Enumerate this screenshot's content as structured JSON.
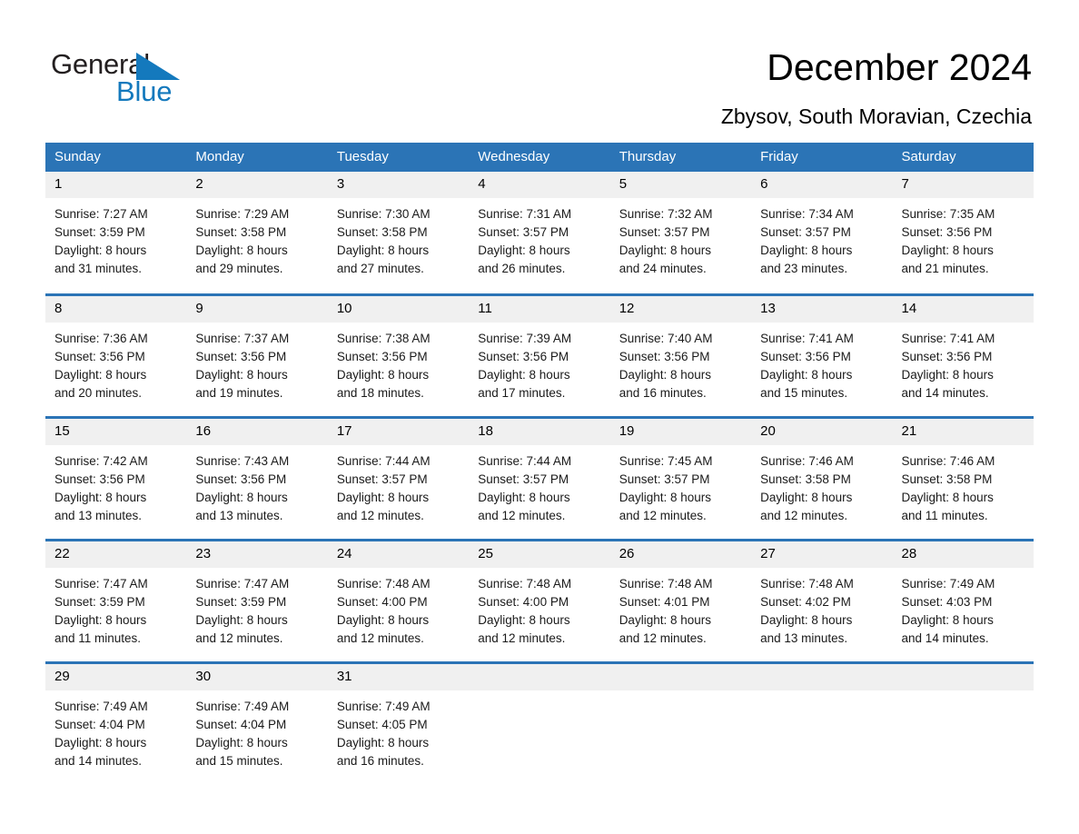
{
  "brand": {
    "name_part1": "General",
    "name_part2": "Blue",
    "accent_color": "#1479bd",
    "header_color": "#2b74b6"
  },
  "header": {
    "title": "December 2024",
    "location": "Zbysov, South Moravian, Czechia"
  },
  "weekday_headers": [
    "Sunday",
    "Monday",
    "Tuesday",
    "Wednesday",
    "Thursday",
    "Friday",
    "Saturday"
  ],
  "weeks": [
    [
      {
        "day": "1",
        "sunrise": "Sunrise: 7:27 AM",
        "sunset": "Sunset: 3:59 PM",
        "daylight_line1": "Daylight: 8 hours",
        "daylight_line2": "and 31 minutes."
      },
      {
        "day": "2",
        "sunrise": "Sunrise: 7:29 AM",
        "sunset": "Sunset: 3:58 PM",
        "daylight_line1": "Daylight: 8 hours",
        "daylight_line2": "and 29 minutes."
      },
      {
        "day": "3",
        "sunrise": "Sunrise: 7:30 AM",
        "sunset": "Sunset: 3:58 PM",
        "daylight_line1": "Daylight: 8 hours",
        "daylight_line2": "and 27 minutes."
      },
      {
        "day": "4",
        "sunrise": "Sunrise: 7:31 AM",
        "sunset": "Sunset: 3:57 PM",
        "daylight_line1": "Daylight: 8 hours",
        "daylight_line2": "and 26 minutes."
      },
      {
        "day": "5",
        "sunrise": "Sunrise: 7:32 AM",
        "sunset": "Sunset: 3:57 PM",
        "daylight_line1": "Daylight: 8 hours",
        "daylight_line2": "and 24 minutes."
      },
      {
        "day": "6",
        "sunrise": "Sunrise: 7:34 AM",
        "sunset": "Sunset: 3:57 PM",
        "daylight_line1": "Daylight: 8 hours",
        "daylight_line2": "and 23 minutes."
      },
      {
        "day": "7",
        "sunrise": "Sunrise: 7:35 AM",
        "sunset": "Sunset: 3:56 PM",
        "daylight_line1": "Daylight: 8 hours",
        "daylight_line2": "and 21 minutes."
      }
    ],
    [
      {
        "day": "8",
        "sunrise": "Sunrise: 7:36 AM",
        "sunset": "Sunset: 3:56 PM",
        "daylight_line1": "Daylight: 8 hours",
        "daylight_line2": "and 20 minutes."
      },
      {
        "day": "9",
        "sunrise": "Sunrise: 7:37 AM",
        "sunset": "Sunset: 3:56 PM",
        "daylight_line1": "Daylight: 8 hours",
        "daylight_line2": "and 19 minutes."
      },
      {
        "day": "10",
        "sunrise": "Sunrise: 7:38 AM",
        "sunset": "Sunset: 3:56 PM",
        "daylight_line1": "Daylight: 8 hours",
        "daylight_line2": "and 18 minutes."
      },
      {
        "day": "11",
        "sunrise": "Sunrise: 7:39 AM",
        "sunset": "Sunset: 3:56 PM",
        "daylight_line1": "Daylight: 8 hours",
        "daylight_line2": "and 17 minutes."
      },
      {
        "day": "12",
        "sunrise": "Sunrise: 7:40 AM",
        "sunset": "Sunset: 3:56 PM",
        "daylight_line1": "Daylight: 8 hours",
        "daylight_line2": "and 16 minutes."
      },
      {
        "day": "13",
        "sunrise": "Sunrise: 7:41 AM",
        "sunset": "Sunset: 3:56 PM",
        "daylight_line1": "Daylight: 8 hours",
        "daylight_line2": "and 15 minutes."
      },
      {
        "day": "14",
        "sunrise": "Sunrise: 7:41 AM",
        "sunset": "Sunset: 3:56 PM",
        "daylight_line1": "Daylight: 8 hours",
        "daylight_line2": "and 14 minutes."
      }
    ],
    [
      {
        "day": "15",
        "sunrise": "Sunrise: 7:42 AM",
        "sunset": "Sunset: 3:56 PM",
        "daylight_line1": "Daylight: 8 hours",
        "daylight_line2": "and 13 minutes."
      },
      {
        "day": "16",
        "sunrise": "Sunrise: 7:43 AM",
        "sunset": "Sunset: 3:56 PM",
        "daylight_line1": "Daylight: 8 hours",
        "daylight_line2": "and 13 minutes."
      },
      {
        "day": "17",
        "sunrise": "Sunrise: 7:44 AM",
        "sunset": "Sunset: 3:57 PM",
        "daylight_line1": "Daylight: 8 hours",
        "daylight_line2": "and 12 minutes."
      },
      {
        "day": "18",
        "sunrise": "Sunrise: 7:44 AM",
        "sunset": "Sunset: 3:57 PM",
        "daylight_line1": "Daylight: 8 hours",
        "daylight_line2": "and 12 minutes."
      },
      {
        "day": "19",
        "sunrise": "Sunrise: 7:45 AM",
        "sunset": "Sunset: 3:57 PM",
        "daylight_line1": "Daylight: 8 hours",
        "daylight_line2": "and 12 minutes."
      },
      {
        "day": "20",
        "sunrise": "Sunrise: 7:46 AM",
        "sunset": "Sunset: 3:58 PM",
        "daylight_line1": "Daylight: 8 hours",
        "daylight_line2": "and 12 minutes."
      },
      {
        "day": "21",
        "sunrise": "Sunrise: 7:46 AM",
        "sunset": "Sunset: 3:58 PM",
        "daylight_line1": "Daylight: 8 hours",
        "daylight_line2": "and 11 minutes."
      }
    ],
    [
      {
        "day": "22",
        "sunrise": "Sunrise: 7:47 AM",
        "sunset": "Sunset: 3:59 PM",
        "daylight_line1": "Daylight: 8 hours",
        "daylight_line2": "and 11 minutes."
      },
      {
        "day": "23",
        "sunrise": "Sunrise: 7:47 AM",
        "sunset": "Sunset: 3:59 PM",
        "daylight_line1": "Daylight: 8 hours",
        "daylight_line2": "and 12 minutes."
      },
      {
        "day": "24",
        "sunrise": "Sunrise: 7:48 AM",
        "sunset": "Sunset: 4:00 PM",
        "daylight_line1": "Daylight: 8 hours",
        "daylight_line2": "and 12 minutes."
      },
      {
        "day": "25",
        "sunrise": "Sunrise: 7:48 AM",
        "sunset": "Sunset: 4:00 PM",
        "daylight_line1": "Daylight: 8 hours",
        "daylight_line2": "and 12 minutes."
      },
      {
        "day": "26",
        "sunrise": "Sunrise: 7:48 AM",
        "sunset": "Sunset: 4:01 PM",
        "daylight_line1": "Daylight: 8 hours",
        "daylight_line2": "and 12 minutes."
      },
      {
        "day": "27",
        "sunrise": "Sunrise: 7:48 AM",
        "sunset": "Sunset: 4:02 PM",
        "daylight_line1": "Daylight: 8 hours",
        "daylight_line2": "and 13 minutes."
      },
      {
        "day": "28",
        "sunrise": "Sunrise: 7:49 AM",
        "sunset": "Sunset: 4:03 PM",
        "daylight_line1": "Daylight: 8 hours",
        "daylight_line2": "and 14 minutes."
      }
    ],
    [
      {
        "day": "29",
        "sunrise": "Sunrise: 7:49 AM",
        "sunset": "Sunset: 4:04 PM",
        "daylight_line1": "Daylight: 8 hours",
        "daylight_line2": "and 14 minutes."
      },
      {
        "day": "30",
        "sunrise": "Sunrise: 7:49 AM",
        "sunset": "Sunset: 4:04 PM",
        "daylight_line1": "Daylight: 8 hours",
        "daylight_line2": "and 15 minutes."
      },
      {
        "day": "31",
        "sunrise": "Sunrise: 7:49 AM",
        "sunset": "Sunset: 4:05 PM",
        "daylight_line1": "Daylight: 8 hours",
        "daylight_line2": "and 16 minutes."
      },
      {
        "day": "",
        "sunrise": "",
        "sunset": "",
        "daylight_line1": "",
        "daylight_line2": ""
      },
      {
        "day": "",
        "sunrise": "",
        "sunset": "",
        "daylight_line1": "",
        "daylight_line2": ""
      },
      {
        "day": "",
        "sunrise": "",
        "sunset": "",
        "daylight_line1": "",
        "daylight_line2": ""
      },
      {
        "day": "",
        "sunrise": "",
        "sunset": "",
        "daylight_line1": "",
        "daylight_line2": ""
      }
    ]
  ]
}
